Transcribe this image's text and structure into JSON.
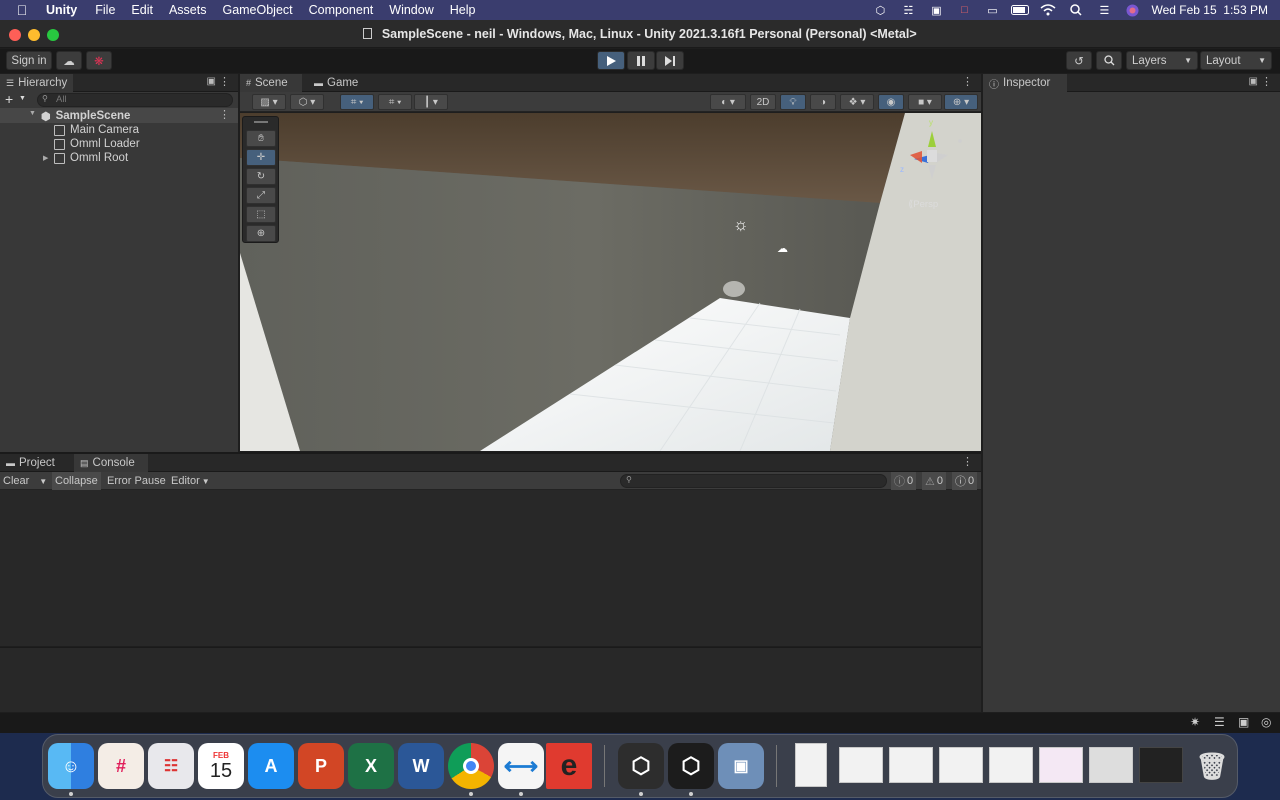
{
  "menubar": {
    "app_name": "Unity",
    "items": [
      "File",
      "Edit",
      "Assets",
      "GameObject",
      "Component",
      "Window",
      "Help"
    ],
    "clock": "Wed Feb 15  1:53 PM"
  },
  "window": {
    "title": "SampleScene - neil - Windows, Mac, Linux - Unity 2021.3.16f1 Personal (Personal) <Metal>"
  },
  "toolbar": {
    "sign_in": "Sign in",
    "layers": "Layers",
    "layout": "Layout"
  },
  "hierarchy": {
    "tab": "Hierarchy",
    "search_placeholder": "All",
    "scene": "SampleScene",
    "items": [
      "Main Camera",
      "Omml Loader",
      "Omml Root"
    ]
  },
  "scene_view": {
    "tabs": [
      "Scene",
      "Game"
    ],
    "btn_2d": "2D",
    "gizmo_label": "Persp",
    "gizmo_axes": [
      "y",
      "z"
    ]
  },
  "inspector": {
    "tab": "Inspector"
  },
  "bottom_panel": {
    "tabs": [
      "Project",
      "Console"
    ],
    "clear": "Clear",
    "collapse": "Collapse",
    "error_pause": "Error Pause",
    "editor": "Editor",
    "counts": [
      "0",
      "0",
      "0"
    ]
  },
  "dock": {
    "calendar_month": "FEB",
    "calendar_day": "15"
  },
  "colors": {
    "menubar": "#3a3d6e",
    "accent_blue": "#46607c",
    "panel": "#383838",
    "scene_sky": "#5b4a35",
    "scene_floor": "#eef0f0"
  }
}
